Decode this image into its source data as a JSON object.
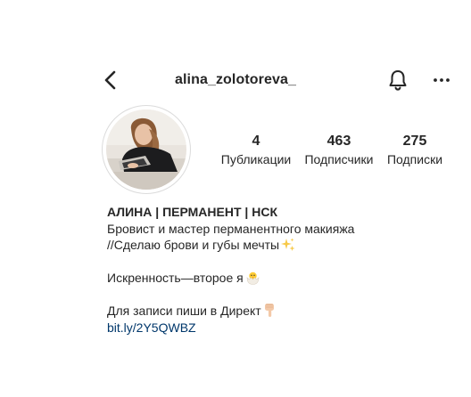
{
  "header": {
    "username": "alina_zolotoreva_",
    "back_icon": "chevron-left-icon",
    "bell_icon": "bell-icon",
    "more_icon": "more-horizontal-icon"
  },
  "stats": [
    {
      "value": "4",
      "label": "Публикации"
    },
    {
      "value": "463",
      "label": "Подписчики"
    },
    {
      "value": "275",
      "label": "Подписки"
    }
  ],
  "bio": {
    "name": "АЛИНА | ПЕРМАНЕНТ | НСК",
    "line1": "Бровист и мастер перманентного макияжа",
    "line2": "//Сделаю брови и губы мечты",
    "line2_emoji": "sparkles-icon",
    "line3": "Искренность—второе я",
    "line3_emoji": "hatching-chick-icon",
    "line4": "Для записи пиши в Директ",
    "line4_emoji": "pointing-down-icon",
    "link": "bit.ly/2Y5QWBZ"
  },
  "colors": {
    "text": "#262626",
    "link": "#00376b",
    "avatar_ring": "#dbdbdb"
  }
}
